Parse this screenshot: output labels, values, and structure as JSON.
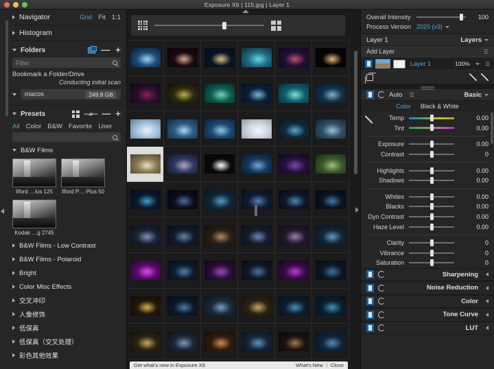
{
  "window": {
    "title": "Exposure X6 | 115.jpg | Layer 1",
    "traffic_lights": [
      "close",
      "minimize",
      "zoom"
    ]
  },
  "left_panel": {
    "navigator": {
      "label": "Navigator",
      "options": [
        "Grid",
        "Fit",
        "1:1"
      ],
      "active_option": "Grid"
    },
    "histogram": {
      "label": "Histogram"
    },
    "folders": {
      "label": "Folders",
      "filter_placeholder": "Filter",
      "bookmark_label": "Bookmark a Folder/Drive",
      "status": "Conducting initial scan",
      "drive": {
        "name": "macos",
        "size": "249.8 GB"
      },
      "add_label": "+",
      "remove_label": "—"
    },
    "presets": {
      "label": "Presets",
      "tabs": [
        "All",
        "Color",
        "B&W",
        "Favorite",
        "User"
      ],
      "active_tab": "All",
      "search_placeholder": "",
      "open_group": {
        "label": "B&W Films",
        "items": [
          {
            "name": "Ilford …lus 125"
          },
          {
            "name": "Ilford P… Plus 50"
          },
          {
            "name": "Kodak …g 2745"
          }
        ]
      },
      "groups": [
        "B&W Films - Low Contrast",
        "B&W Films - Polaroid",
        "Bright",
        "Color Misc Effects",
        "交叉冲印",
        "人像修饰",
        "低保真",
        "低保真（交叉处理）",
        "彩色其他效果"
      ]
    }
  },
  "center": {
    "toolbar": {
      "small_grid_icon": "grid-small-icon",
      "large_grid_icon": "grid-large-icon",
      "zoom_value": 62
    },
    "grid": {
      "columns": 6,
      "rows": 9,
      "selected_index": 18,
      "cells": [
        {
          "c1": "#1d4e7a",
          "c2": "#9fd2f2",
          "c3": "#061527"
        },
        {
          "c1": "#1a0a10",
          "c2": "#d8a78c",
          "c3": "#070309"
        },
        {
          "c1": "#0a1624",
          "c2": "#e0c27c",
          "c3": "#050a12"
        },
        {
          "c1": "#1f6f86",
          "c2": "#69d6e0",
          "c3": "#0d2b39"
        },
        {
          "c1": "#22103a",
          "c2": "#c05070",
          "c3": "#0a0618"
        },
        {
          "c1": "#060606",
          "c2": "#e8b878",
          "c3": "#020202"
        },
        {
          "c1": "#2a0f2d",
          "c2": "#8a2250",
          "c3": "#0a0412"
        },
        {
          "c1": "#2e2a0f",
          "c2": "#b9a84c",
          "c3": "#0d0b04"
        },
        {
          "c1": "#0c5f52",
          "c2": "#6ed8b0",
          "c3": "#04231f"
        },
        {
          "c1": "#0b2038",
          "c2": "#6fb6d8",
          "c3": "#03101c"
        },
        {
          "c1": "#106070",
          "c2": "#7fe2d6",
          "c3": "#062b33"
        },
        {
          "c1": "#123148",
          "c2": "#7fb2cc",
          "c3": "#07192a"
        },
        {
          "c1": "#a8c6df",
          "c2": "#e9f1f7",
          "c3": "#5b7d95"
        },
        {
          "c1": "#2b5a85",
          "c2": "#a9d8f2",
          "c3": "#12293c"
        },
        {
          "c1": "#1c4a74",
          "c2": "#8cc5e8",
          "c3": "#0a1f31"
        },
        {
          "c1": "#cfd8e0",
          "c2": "#f4f8fb",
          "c3": "#8d9aa6"
        },
        {
          "c1": "#0e2c40",
          "c2": "#5ea5c8",
          "c3": "#05131d"
        },
        {
          "c1": "#30506a",
          "c2": "#9cc2d8",
          "c3": "#13212d"
        },
        {
          "c1": "#8a7a55",
          "c2": "#e9dfc2",
          "c3": "#4a4029"
        },
        {
          "c1": "#2c3a5e",
          "c2": "#b99fc8",
          "c3": "#0f1426"
        },
        {
          "c1": "#0a0a0a",
          "c2": "#ffffff",
          "c3": "#050505"
        },
        {
          "c1": "#163860",
          "c2": "#6fa8d8",
          "c3": "#081728"
        },
        {
          "c1": "#2a1040",
          "c2": "#7a46b0",
          "c3": "#0c0518"
        },
        {
          "c1": "#3c5a2c",
          "c2": "#9ec07a",
          "c3": "#1a2812"
        },
        {
          "c1": "#0b1a2c",
          "c2": "#3f9ad2",
          "c3": "#040a14"
        },
        {
          "c1": "#0a0e1a",
          "c2": "#4a6a9a",
          "c3": "#03050a"
        },
        {
          "c1": "#12283c",
          "c2": "#4f9cc4",
          "c3": "#07131d"
        },
        {
          "c1": "#101c30",
          "c2": "#5080b8",
          "c3": "#060c16"
        },
        {
          "c1": "#0d1828",
          "c2": "#4a86b8",
          "c3": "#050a12"
        },
        {
          "c1": "#0a1420",
          "c2": "#3e7aa8",
          "c3": "#04080e"
        },
        {
          "c1": "#1a2438",
          "c2": "#7e92b4",
          "c3": "#0a0e18"
        },
        {
          "c1": "#121c2e",
          "c2": "#6080a8",
          "c3": "#070b14"
        },
        {
          "c1": "#2a2018",
          "c2": "#b08858",
          "c3": "#120e08"
        },
        {
          "c1": "#161e30",
          "c2": "#6a88b0",
          "c3": "#080c14"
        },
        {
          "c1": "#241a2e",
          "c2": "#9a7ab0",
          "c3": "#0e0a14"
        },
        {
          "c1": "#14263a",
          "c2": "#5c9ac0",
          "c3": "#08121c"
        },
        {
          "c1": "#5a0c6e",
          "c2": "#e04ae8",
          "c3": "#1e0426"
        },
        {
          "c1": "#0e1c2e",
          "c2": "#4a80b0",
          "c3": "#060c16"
        },
        {
          "c1": "#2a1038",
          "c2": "#a044c0",
          "c3": "#0e0514"
        },
        {
          "c1": "#101828",
          "c2": "#4a74a0",
          "c3": "#060a12"
        },
        {
          "c1": "#3a0a48",
          "c2": "#c038d8",
          "c3": "#140320"
        },
        {
          "c1": "#0c1826",
          "c2": "#3e72a0",
          "c3": "#050a10"
        },
        {
          "c1": "#241808",
          "c2": "#d8b050",
          "c3": "#0e0904"
        },
        {
          "c1": "#0d1a2a",
          "c2": "#4878a8",
          "c3": "#050a12"
        },
        {
          "c1": "#1a2a3c",
          "c2": "#6ea0c0",
          "c3": "#0c141e"
        },
        {
          "c1": "#2c2414",
          "c2": "#c0a860",
          "c3": "#121008"
        },
        {
          "c1": "#0e1e30",
          "c2": "#4c88b8",
          "c3": "#060e18"
        },
        {
          "c1": "#0a2030",
          "c2": "#3e90b8",
          "c3": "#041018"
        },
        {
          "c1": "#2a2214",
          "c2": "#c8a860",
          "c3": "#120e08"
        },
        {
          "c1": "#1c2638",
          "c2": "#7a96b8",
          "c3": "#0c1018"
        },
        {
          "c1": "#301c10",
          "c2": "#d09050",
          "c3": "#140c06"
        },
        {
          "c1": "#142638",
          "c2": "#5a94bc",
          "c3": "#08121c"
        },
        {
          "c1": "#1a1410",
          "c2": "#9c7850",
          "c3": "#0a0806"
        },
        {
          "c1": "#12243a",
          "c2": "#5088b8",
          "c3": "#07121e"
        }
      ]
    },
    "bottom_bar": {
      "left_text": "Get what's new in Exposure X6",
      "right_links": [
        "What's New",
        "Close"
      ]
    }
  },
  "right_panel": {
    "overall_intensity": {
      "label": "Overall Intensity",
      "value": "100",
      "slider_pct": 88
    },
    "process_version": {
      "label": "Process Version",
      "value": "2020 (v3)"
    },
    "layers": {
      "current_layer": "Layer 1",
      "header_label": "Layers",
      "add_layer_label": "Add Layer",
      "item": {
        "name": "Layer 1",
        "opacity": "100%"
      }
    },
    "tools": {
      "crop_icon": "crop-icon",
      "brush_icon": "brush-icon",
      "eraser_icon": "eraser-icon"
    },
    "basic": {
      "auto_label": "Auto",
      "panel_label": "Basic",
      "mode_tabs": [
        "Color",
        "Black & White"
      ],
      "active_mode": "Color",
      "sliders": [
        {
          "name": "Temp",
          "value": "0.00",
          "track": "temp"
        },
        {
          "name": "Tint",
          "value": "0.00",
          "track": "tint"
        },
        {
          "name": "Exposure",
          "value": "0.00",
          "track": "plain"
        },
        {
          "name": "Contrast",
          "value": "0",
          "track": "plain"
        },
        {
          "name": "Highlights",
          "value": "0.00",
          "track": "plain"
        },
        {
          "name": "Shadows",
          "value": "0.00",
          "track": "plain"
        },
        {
          "name": "Whites",
          "value": "0.00",
          "track": "plain"
        },
        {
          "name": "Blacks",
          "value": "0.00",
          "track": "plain"
        },
        {
          "name": "Dyn Contrast",
          "value": "0.00",
          "track": "plain"
        },
        {
          "name": "Haze Level",
          "value": "0.00",
          "track": "plain"
        },
        {
          "name": "Clarity",
          "value": "0",
          "track": "plain"
        },
        {
          "name": "Vibrance",
          "value": "0",
          "track": "plain"
        },
        {
          "name": "Saturation",
          "value": "0",
          "track": "plain"
        }
      ]
    },
    "sections": [
      "Sharpening",
      "Noise Reduction",
      "Color",
      "Tone Curve",
      "LUT"
    ]
  },
  "colors": {
    "accent_blue": "#4ea3e0",
    "toggle_blue": "#1766a8",
    "panel_bg": "#262626",
    "canvas_bg": "#1b1b1b"
  }
}
